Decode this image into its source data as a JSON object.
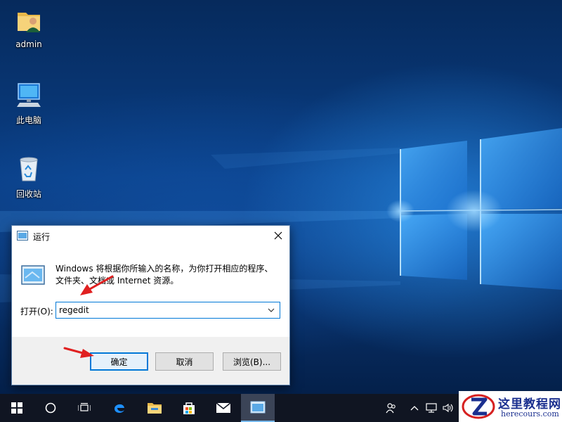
{
  "desktop": {
    "icons": [
      {
        "label": "admin",
        "icon": "user-folder-icon"
      },
      {
        "label": "此电脑",
        "icon": "this-pc-icon"
      },
      {
        "label": "回收站",
        "icon": "recycle-bin-icon"
      }
    ]
  },
  "run_dialog": {
    "title": "运行",
    "description": "Windows 将根据你所输入的名称，为你打开相应的程序、文件夹、文档或 Internet 资源。",
    "open_label": "打开(O):",
    "input_value": "regedit",
    "buttons": {
      "ok": "确定",
      "cancel": "取消",
      "browse": "浏览(B)..."
    },
    "accent_color": "#0078d7"
  },
  "taskbar": {
    "buttons": [
      "start-icon",
      "cortana-icon",
      "task-view-icon",
      "edge-icon",
      "file-explorer-icon",
      "store-icon",
      "mail-icon",
      "run-icon"
    ],
    "tray": [
      "people-icon",
      "chevron-up-icon",
      "network-icon",
      "volume-icon"
    ]
  },
  "watermark": {
    "name": "这里教程网",
    "url": "herecours.com"
  }
}
